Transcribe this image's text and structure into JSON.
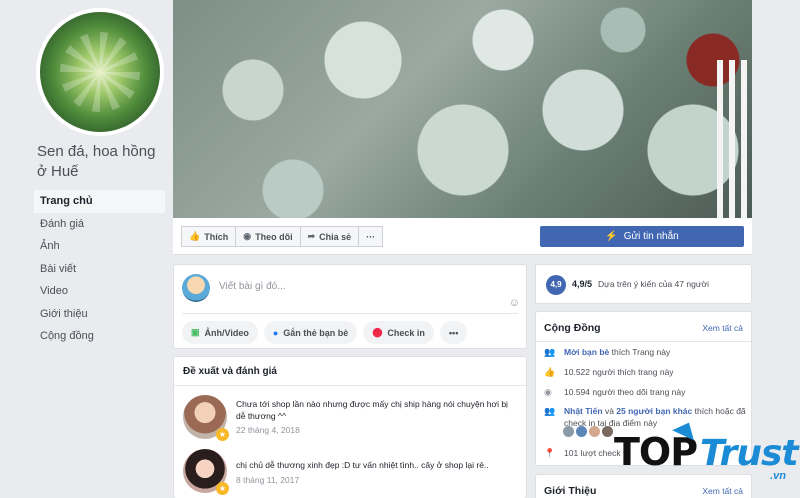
{
  "page": {
    "name": "Sen đá, hoa hồng ở Huế"
  },
  "nav": [
    {
      "label": "Trang chủ",
      "active": true
    },
    {
      "label": "Đánh giá"
    },
    {
      "label": "Ảnh"
    },
    {
      "label": "Bài viết"
    },
    {
      "label": "Video"
    },
    {
      "label": "Giới thiệu"
    },
    {
      "label": "Cộng đồng"
    }
  ],
  "actions": {
    "like": "Thích",
    "follow": "Theo dõi",
    "share": "Chia sẻ",
    "more": "···",
    "send_message": "Gửi tin nhắn"
  },
  "composer": {
    "placeholder": "Viết bài gì đó...",
    "photo_video": "Ảnh/Video",
    "tag_friends": "Gắn thẻ bạn bè",
    "check_in": "Check in",
    "more": "•••"
  },
  "suggest": {
    "title": "Đề xuất và đánh giá",
    "reviews": [
      {
        "text": "Chưa tới shop lần nào nhưng được mấy chị ship hàng nói chuyện hơi bị dễ thương ^^",
        "date": "22 tháng 4, 2018"
      },
      {
        "text": "chị chủ dễ thương xinh đẹp :D tư vấn nhiệt tình.. cây ở shop lại rẻ..",
        "date": "8 tháng 11, 2017"
      }
    ]
  },
  "rating": {
    "badge": "4,9",
    "score": "4,9/5",
    "desc": "Dựa trên ý kiến của 47 người"
  },
  "community": {
    "title": "Cộng Đồng",
    "see_all": "Xem tất cả",
    "invite_link": "Mời bạn bè",
    "invite_rest": " thích Trang này",
    "likes": "10.522 người thích trang này",
    "follows": "10.594 người theo dõi trang này",
    "checkin_name": "Nhật Tiến",
    "checkin_mid": " và ",
    "checkin_friends": "25 người bạn khác",
    "checkin_rest": " thích hoặc đã check in tại địa điểm này",
    "visits": "101 lượt check in"
  },
  "about": {
    "title": "Giới Thiệu",
    "see_all": "Xem tất cả"
  },
  "watermark": {
    "top": "TOP",
    "trust": "Trust",
    "vn": ".vn"
  },
  "colors": {
    "accent": "#4267b2",
    "star": "#f7b928",
    "brand_blue": "#1b8bd6"
  }
}
